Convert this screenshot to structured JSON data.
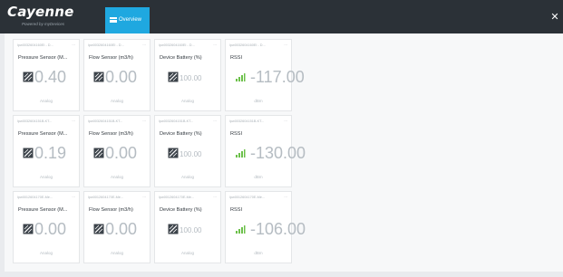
{
  "app": {
    "logo_text": "Cayenne",
    "logo_subtitle": "Powered by myDevices",
    "tab_label": "Overview",
    "close_icon": "close-icon"
  },
  "rows": [
    {
      "cards": [
        {
          "id": "lpw0032604160EI - D...",
          "title": "Pressure Sensor (M...",
          "value": "0.40",
          "unit": "Analog",
          "icon": "analog-sensor-icon"
        },
        {
          "id": "lpw0032604160EI - D...",
          "title": "Flow Sensor (m3/h)",
          "value": "0.00",
          "unit": "Analog",
          "icon": "analog-sensor-icon"
        },
        {
          "id": "lpw0032604160EI - D...",
          "title": "Device Battery (%)",
          "value": "100.00",
          "unit": "Analog",
          "icon": "analog-sensor-icon"
        },
        {
          "id": "lpw0032604160EI - D...",
          "title": "RSSI",
          "value": "-117.00",
          "unit": "dBm",
          "icon": "signal-icon"
        }
      ]
    },
    {
      "cards": [
        {
          "id": "lpw0032604151B-KT...",
          "title": "Pressure Sensor (M...",
          "value": "0.19",
          "unit": "Analog",
          "icon": "analog-sensor-icon"
        },
        {
          "id": "lpw0032604151B-KT...",
          "title": "Flow Sensor (m3/h)",
          "value": "0.00",
          "unit": "Analog",
          "icon": "analog-sensor-icon"
        },
        {
          "id": "lpw0032604151B-KT...",
          "title": "Device Battery (%)",
          "value": "100.00",
          "unit": "Analog",
          "icon": "analog-sensor-icon"
        },
        {
          "id": "lpw0032604151B-KT...",
          "title": "RSSI",
          "value": "-130.00",
          "unit": "dBm",
          "icon": "signal-icon"
        }
      ]
    },
    {
      "cards": [
        {
          "id": "lpw0012604170E-Me...",
          "title": "Pressure Sensor (M...",
          "value": "0.00",
          "unit": "Analog",
          "icon": "analog-sensor-icon"
        },
        {
          "id": "lpw0012604170E-Me...",
          "title": "Flow Sensor (m3/h)",
          "value": "0.00",
          "unit": "Analog",
          "icon": "analog-sensor-icon"
        },
        {
          "id": "lpw0012604170E-Me...",
          "title": "Device Battery (%)",
          "value": "100.00",
          "unit": "Analog",
          "icon": "analog-sensor-icon"
        },
        {
          "id": "lpw0012604170E-Me...",
          "title": "RSSI",
          "value": "-106.00",
          "unit": "dBm",
          "icon": "signal-icon"
        }
      ]
    }
  ],
  "colors": {
    "topbar": "#2b3137",
    "tab_active": "#1fa8e0",
    "signal_green": "#6cc04a",
    "value_gray": "#b5bcc2"
  }
}
